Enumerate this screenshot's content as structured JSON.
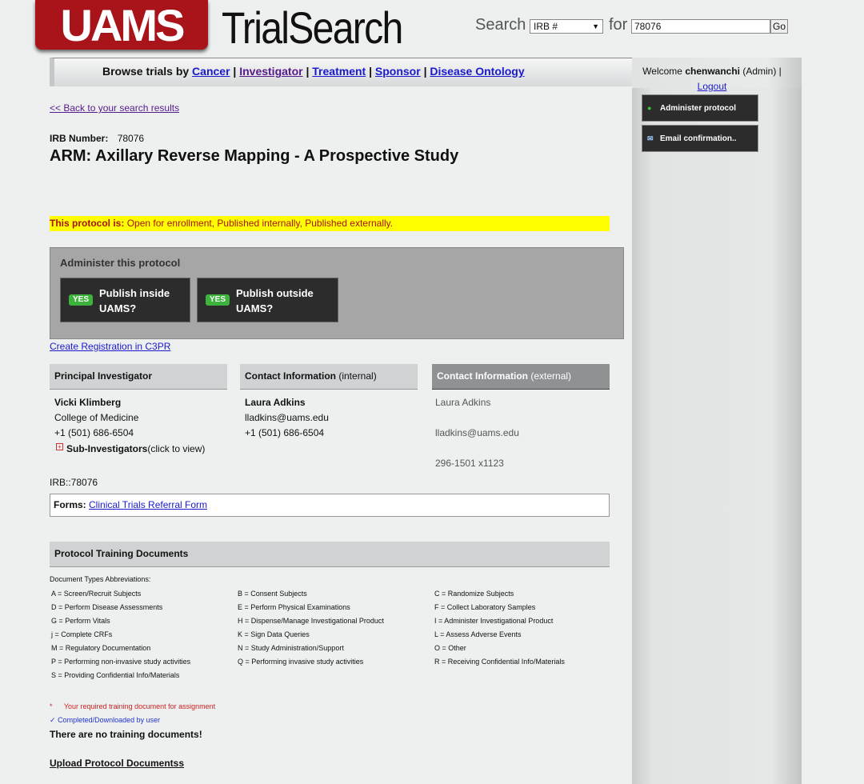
{
  "header": {
    "logo_text": "UAMS",
    "app_title": "TrialSearch",
    "search_label": "Search",
    "search_type": "IRB #",
    "for_label": "for",
    "search_value": "78076",
    "go_label": "Go"
  },
  "nav": {
    "browse_label": "Browse trials by",
    "links": [
      "Cancer",
      "Investigator",
      "Treatment",
      "Sponsor",
      "Disease Ontology"
    ],
    "separator": "|"
  },
  "user": {
    "welcome_prefix": "Welcome",
    "username": "chenwanchi",
    "role": "(Admin) |",
    "logout_label": "Logout"
  },
  "sidebar": {
    "administer_label": "Administer protocol",
    "email_label": "Email confirmation.."
  },
  "protocol": {
    "back_link": "<< Back to your search results",
    "irb_label": "IRB Number:",
    "irb_number": "78076",
    "title": "ARM: Axillary Reverse Mapping - A Prospective Study",
    "status_label": "This protocol is:",
    "status_text": "Open for enrollment, Published internally, Published externally."
  },
  "admin": {
    "title": "Administer this protocol",
    "publish_inside": {
      "badge": "YES",
      "line1": "Publish inside",
      "line2": "UAMS?"
    },
    "publish_outside": {
      "badge": "YES",
      "line1": "Publish outside",
      "line2": "UAMS?"
    }
  },
  "c3pr_link": "Create Registration in C3PR",
  "principal_investigator": {
    "header": "Principal Investigator",
    "name": "Vicki Klimberg",
    "dept": "College of Medicine",
    "phone": "+1 (501) 686-6504",
    "sub_label": "Sub-Investigators",
    "sub_hint": "(click to view)"
  },
  "contact_internal": {
    "header": "Contact Information",
    "header_sub": "(internal)",
    "name": "Laura Adkins",
    "email": "lladkins@uams.edu",
    "phone": "+1 (501) 686-6504"
  },
  "contact_external": {
    "header": "Contact Information",
    "header_sub": "(external)",
    "name": "Laura Adkins",
    "email": "lladkins@uams.edu",
    "phone": "296-1501 x1123"
  },
  "irb_footer": "IRB::78076",
  "forms": {
    "label": "Forms:",
    "link": "Clinical Trials Referral Form"
  },
  "training": {
    "header": "Protocol Training Documents",
    "abbr_title": "Document Types Abbreviations:",
    "abbreviations": [
      [
        "A = Screen/Recruit Subjects",
        "B = Consent Subjects",
        "C = Randomize Subjects"
      ],
      [
        "D = Perform Disease Assessments",
        "E = Perform Physical Examinations",
        "F = Collect Laboratory Samples"
      ],
      [
        "G = Perform Vitals",
        "H = Dispense/Manage Investigational Product",
        "I = Administer Investigational Product"
      ],
      [
        "j = Complete CRFs",
        "K = Sign Data Queries",
        "L = Assess Adverse Events"
      ],
      [
        "M = Regulatory Documentation",
        "N = Study Administration/Support",
        "O = Other"
      ],
      [
        "P = Performing non-invasive study activities",
        "Q = Performing invasive study activities",
        "R = Receiving Confidential Info/Materials"
      ],
      [
        "S = Providing Confidential Info/Materials",
        "",
        ""
      ]
    ],
    "required_star": "*",
    "required_text": "Your required training document for assignment",
    "done_mark": "✓",
    "done_text": "Completed/Downloaded by user",
    "no_docs": "There are no training documents!",
    "upload_link": "Upload Protocol Documentss"
  }
}
